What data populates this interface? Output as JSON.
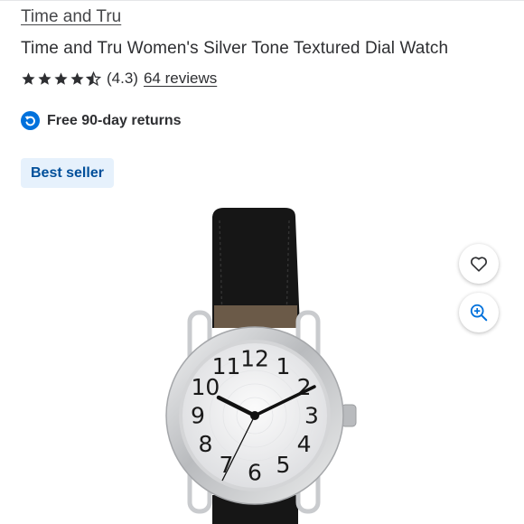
{
  "brand": {
    "label": "Time and Tru"
  },
  "product": {
    "title": "Time and Tru Women's Silver Tone Textured Dial Watch"
  },
  "rating": {
    "value_text": "(4.3)",
    "value": 4.3,
    "max": 5,
    "reviews_label": "64 reviews",
    "star_color": "#2e2f32"
  },
  "returns": {
    "label": "Free 90-day returns",
    "icon": "return-arrow-icon",
    "icon_color": "#0071dc"
  },
  "badge": {
    "label": "Best seller",
    "bg_color": "#e6f1fc",
    "text_color": "#004f9a"
  },
  "image_actions": {
    "favorite_icon": "heart-icon",
    "zoom_icon": "zoom-in-icon"
  },
  "watch": {
    "dial_numbers": [
      "12",
      "1",
      "2",
      "3",
      "4",
      "5",
      "6",
      "7",
      "8",
      "9",
      "10",
      "11"
    ],
    "strap_color": "#161616",
    "case_color": "#c9cbce"
  }
}
